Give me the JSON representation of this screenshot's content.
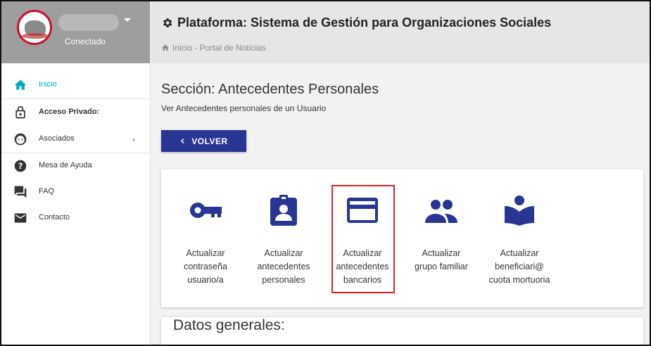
{
  "sidebar": {
    "status": "Conectado",
    "items": [
      {
        "label": "Inicio",
        "icon": "home-icon",
        "active": true
      },
      {
        "label": "Acceso Privado:",
        "icon": "lock-icon",
        "bold": true
      },
      {
        "label": "Asociados",
        "icon": "face-icon",
        "chevron": "›"
      },
      {
        "label": "Mesa de Ayuda",
        "icon": "help-icon"
      },
      {
        "label": "FAQ",
        "icon": "forum-icon"
      },
      {
        "label": "Contacto",
        "icon": "mail-icon"
      }
    ]
  },
  "header": {
    "title": "Plataforma: Sistema de Gestión para Organizaciones Sociales",
    "breadcrumb": "Inicio - Portal de Noticias"
  },
  "main": {
    "section_title": "Sección: Antecedentes Personales",
    "section_sub": "Ver Antecedentes personales de un Usuario",
    "back_label": "VOLVER",
    "actions": [
      {
        "label": "Actualizar\ncontraseña\nusuario/a",
        "icon": "key-icon"
      },
      {
        "label": "Actualizar\nantecedentes\npersonales",
        "icon": "badge-icon"
      },
      {
        "label": "Actualizar\nantecedentes\nbancarios",
        "icon": "credit-card-icon",
        "highlighted": true
      },
      {
        "label": "Actualizar\ngrupo familiar",
        "icon": "people-icon"
      },
      {
        "label": "Actualizar\nbeneficiari@\ncuota mortuoria",
        "icon": "book-reader-icon"
      }
    ],
    "next_section_title": "Datos generales:"
  },
  "colors": {
    "primary": "#283593",
    "active_nav": "#00acc1",
    "highlight": "#e02020",
    "header_bg": "#e6e6e6",
    "profile_bg": "#9e9e9e"
  }
}
